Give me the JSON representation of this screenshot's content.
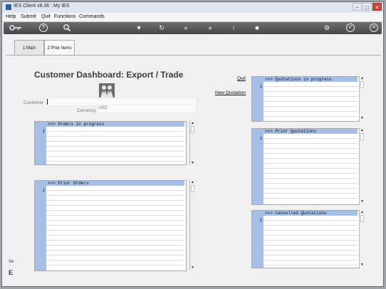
{
  "window": {
    "title": "IES Client v8.36 : My IES"
  },
  "menu": [
    "Help",
    "Submit",
    "Quit",
    "Functions",
    "Commands"
  ],
  "toolbar": {
    "help_glyph": "?",
    "icons": [
      "key-icon",
      "help-icon",
      "search-icon",
      "heart-icon",
      "refresh-icon",
      "rewind-icon",
      "fast-forward-icon",
      "upload-icon",
      "stop-icon",
      "settings-icon",
      "check-icon",
      "close-circle-icon"
    ]
  },
  "tabs": [
    {
      "label": "1 Main"
    },
    {
      "label": "2 Prior Items"
    }
  ],
  "page": {
    "title": "Customer Dashboard: Export / Trade",
    "quit_link": "Quit",
    "new_quotation_link": "New Quotation",
    "customer_label": "Customer",
    "currency_label": "Currency",
    "currency_value": "USD"
  },
  "grids": {
    "orders_in_progress": {
      "header": ">>> Orders in progress",
      "row_number": "1"
    },
    "prior_orders": {
      "header": ">>> Prior Orders",
      "row_number": "1"
    },
    "quotations_in_progress": {
      "header": ">>> Quotations in progress",
      "row_number": "1"
    },
    "prior_quotations": {
      "header": ">>> Prior Quotations",
      "row_number": "1"
    },
    "cancelled_quotations": {
      "header": ">>> Cancelled Quotations",
      "row_number": "1"
    }
  },
  "bottom_left": {
    "line1": "Se",
    "line2": "E"
  },
  "colors": {
    "grid_header": "#a6bfe8",
    "toolbar": "#4a4a4a"
  }
}
